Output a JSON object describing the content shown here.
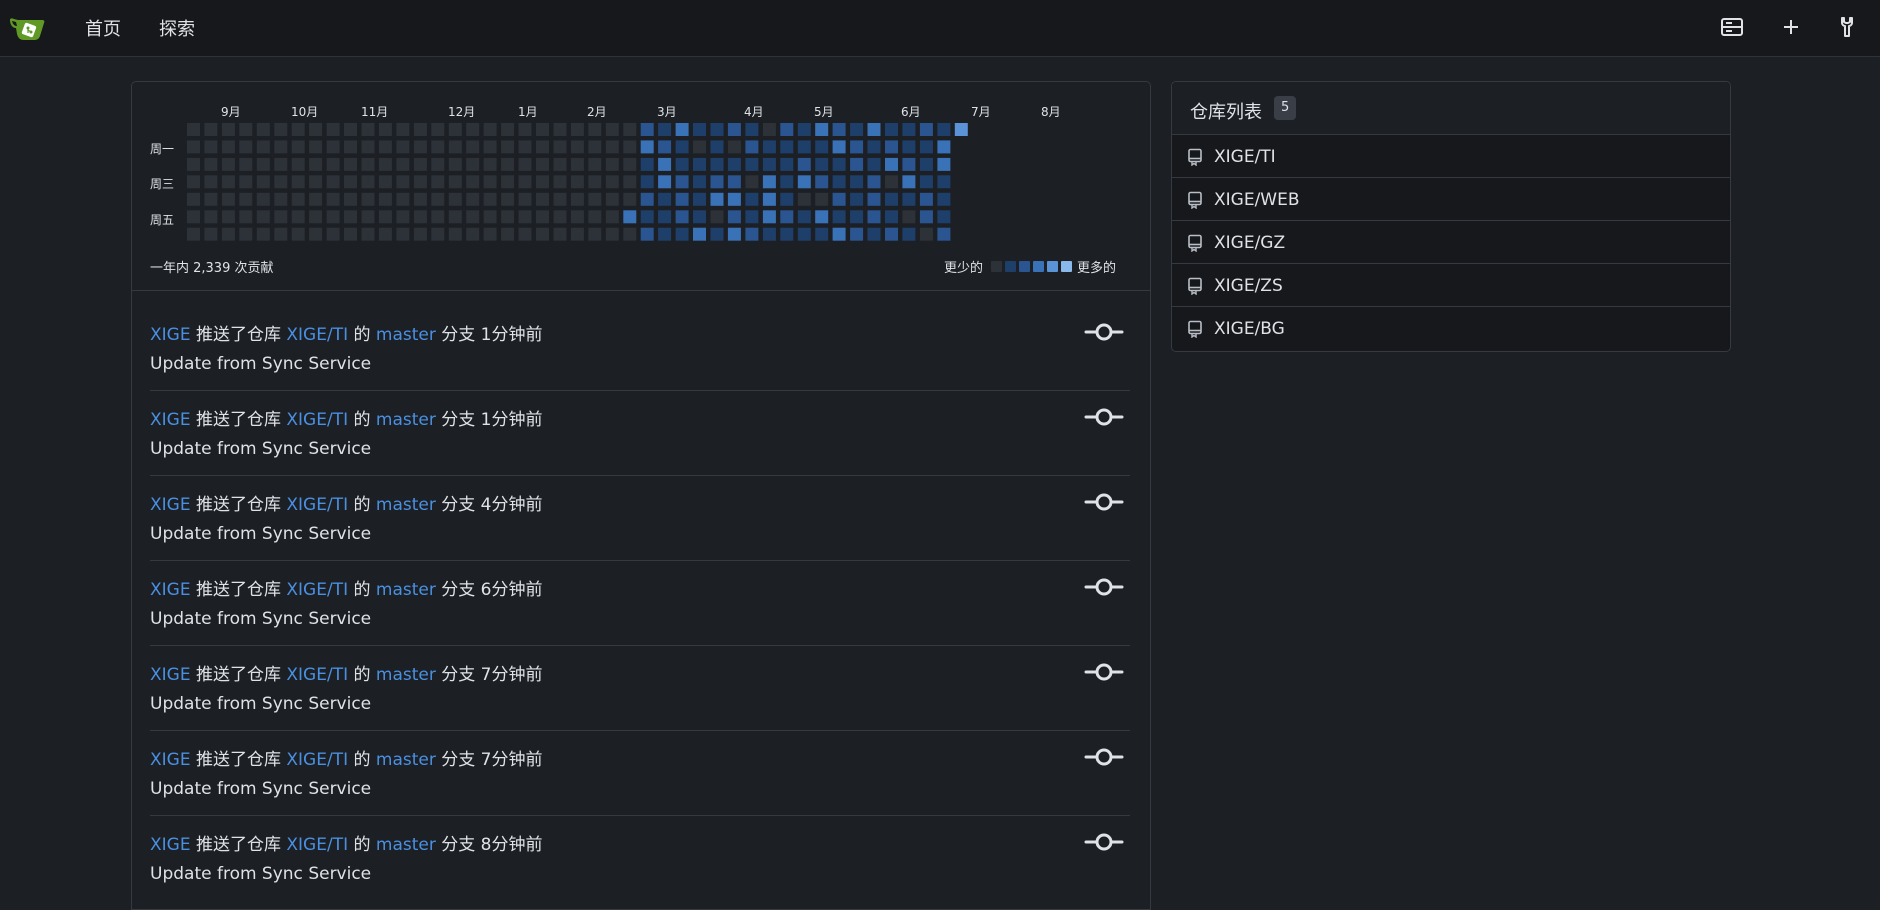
{
  "nav": {
    "home": "首页",
    "explore": "探索"
  },
  "heatmap": {
    "months": [
      "9月",
      "10月",
      "11月",
      "12月",
      "1月",
      "2月",
      "3月",
      "4月",
      "5月",
      "6月",
      "7月",
      "8月"
    ],
    "days": [
      "周一",
      "周三",
      "周五"
    ],
    "total_text": "一年内 2,339 次贡献",
    "legend_less": "更少的",
    "legend_more": "更多的",
    "colors": [
      "#2d3138",
      "#1f3f6b",
      "#2a5591",
      "#3a72b8",
      "#5b94d6"
    ]
  },
  "feed": [
    {
      "user": "XIGE",
      "action": "推送了仓库",
      "repo": "XIGE/TI",
      "of": "的",
      "branch": "master",
      "branch_word": "分支",
      "time": "1分钟前",
      "message": "Update from Sync Service"
    },
    {
      "user": "XIGE",
      "action": "推送了仓库",
      "repo": "XIGE/TI",
      "of": "的",
      "branch": "master",
      "branch_word": "分支",
      "time": "1分钟前",
      "message": "Update from Sync Service"
    },
    {
      "user": "XIGE",
      "action": "推送了仓库",
      "repo": "XIGE/TI",
      "of": "的",
      "branch": "master",
      "branch_word": "分支",
      "time": "4分钟前",
      "message": "Update from Sync Service"
    },
    {
      "user": "XIGE",
      "action": "推送了仓库",
      "repo": "XIGE/TI",
      "of": "的",
      "branch": "master",
      "branch_word": "分支",
      "time": "6分钟前",
      "message": "Update from Sync Service"
    },
    {
      "user": "XIGE",
      "action": "推送了仓库",
      "repo": "XIGE/TI",
      "of": "的",
      "branch": "master",
      "branch_word": "分支",
      "time": "7分钟前",
      "message": "Update from Sync Service"
    },
    {
      "user": "XIGE",
      "action": "推送了仓库",
      "repo": "XIGE/TI",
      "of": "的",
      "branch": "master",
      "branch_word": "分支",
      "time": "7分钟前",
      "message": "Update from Sync Service"
    },
    {
      "user": "XIGE",
      "action": "推送了仓库",
      "repo": "XIGE/TI",
      "of": "的",
      "branch": "master",
      "branch_word": "分支",
      "time": "8分钟前",
      "message": "Update from Sync Service"
    }
  ],
  "repos": {
    "title": "仓库列表",
    "count": "5",
    "items": [
      "XIGE/TI",
      "XIGE/WEB",
      "XIGE/GZ",
      "XIGE/ZS",
      "XIGE/BG"
    ]
  }
}
